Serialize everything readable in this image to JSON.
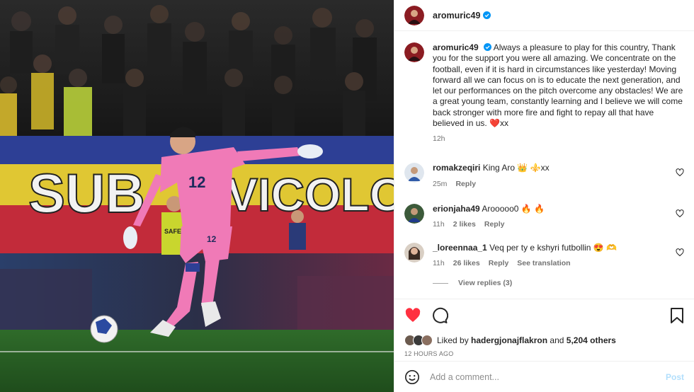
{
  "post": {
    "username": "aromuric49",
    "caption_username": "aromuric49",
    "caption_text": "Always a pleasure to play for this country, Thank you for the support you were all amazing. We concentrate on the football, even if it is hard in circumstances like yesterday! Moving forward all we can focus on is to educate the next generation, and let our performances on the pitch overcome any obstacles! We are a great young team, constantly learning and I believe we will come back stronger with more fire and fight to repay all that have believed in us. ❤️хх",
    "caption_time": "12h"
  },
  "photo": {
    "banner_text": "SUB",
    "banner_text_2": "VICOLOR",
    "jersey_number": "12",
    "shorts_number": "12",
    "sign_text": "SAFE"
  },
  "comments": [
    {
      "username": "romakzeqiri",
      "text": "King Aro 👑 ⚜️хх",
      "time": "25m",
      "likes": "",
      "reply": "Reply",
      "translate": ""
    },
    {
      "username": "erionjaha49",
      "text": "Arooooo0 🔥 🔥",
      "time": "11h",
      "likes": "2 likes",
      "reply": "Reply",
      "translate": ""
    },
    {
      "username": "_loreennaa_1",
      "text": "Veq per ty e kshyri futbollin 😍 🫶",
      "time": "11h",
      "likes": "26 likes",
      "reply": "Reply",
      "translate": "See translation"
    }
  ],
  "view_replies": "View replies (3)",
  "likes": {
    "prefix": "Liked by",
    "user": "hadergjonajflakron",
    "and": "and",
    "others": "5,204 others"
  },
  "timestamp": "12 HOURS AGO",
  "add_comment": {
    "placeholder": "Add a comment...",
    "post_label": "Post"
  },
  "colors": {
    "like_red": "#ff3040",
    "post_blue": "#b2dffc",
    "verified_blue": "#0095f6"
  }
}
